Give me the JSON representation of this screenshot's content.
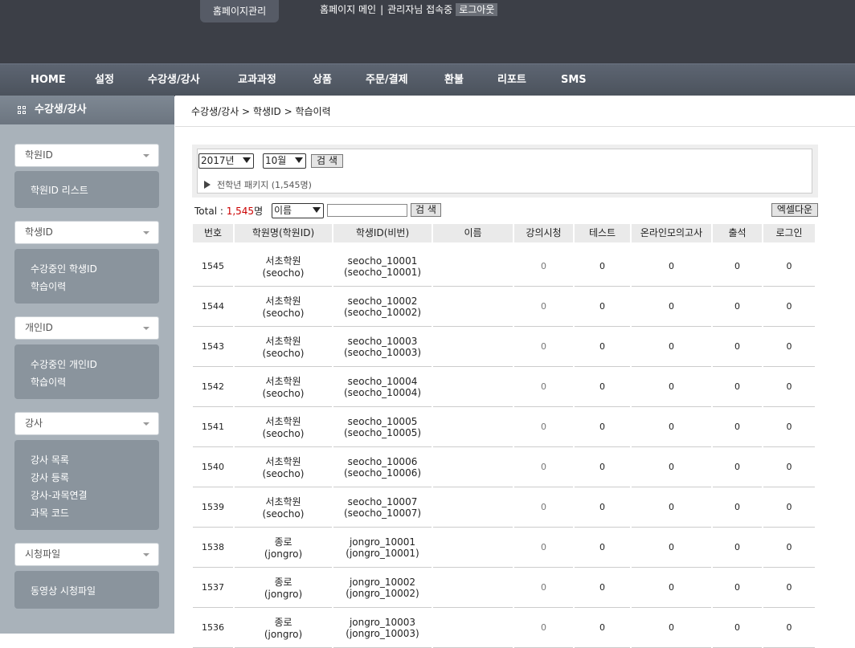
{
  "top": {
    "tab": "홈페이지관리",
    "home_link": "홈페이지 메인",
    "separator": "|",
    "admin_status": "관리자님 접속중",
    "logout": "로그아웃"
  },
  "nav": [
    "HOME",
    "설정",
    "수강생/강사",
    "교과과정",
    "상품",
    "주문/결제",
    "환불",
    "리포트",
    "SMS"
  ],
  "sidebar": {
    "title": "수강생/강사",
    "groups": [
      {
        "select": "학원ID",
        "links": [
          "학원ID 리스트"
        ]
      },
      {
        "select": "학생ID",
        "links": [
          "수강중인 학생ID",
          "학습이력"
        ]
      },
      {
        "select": "개인ID",
        "links": [
          "수강중인 개인ID",
          "학습이력"
        ]
      },
      {
        "select": "강사",
        "links": [
          "강사 목록",
          "강사 등록",
          "강사-과목연결",
          "과목 코드"
        ]
      },
      {
        "select": "시청파일",
        "links": [
          "동영상 시청파일"
        ]
      }
    ]
  },
  "breadcrumb": "수강생/강사 > 학생ID > 학습이력",
  "search": {
    "year": "2017년",
    "month": "10월",
    "search_btn": "검 색",
    "package": "전학년 패키지 (1,545명)"
  },
  "list_bar": {
    "total_label": "Total : ",
    "total_value": "1,545",
    "total_unit": "명",
    "filter": "이름",
    "search_btn": "검 색",
    "excel_btn": "엑셀다운"
  },
  "table": {
    "headers": [
      "번호",
      "학원명(학원ID)",
      "학생ID(비번)",
      "이름",
      "강의시청",
      "테스트",
      "온라인모의고사",
      "출석",
      "로그인"
    ],
    "rows": [
      {
        "no": "1545",
        "academy": "서초학원",
        "academy_id": "(seocho)",
        "student": "seocho_10001",
        "pw": "(seocho_10001)",
        "name": "",
        "lecture": "0",
        "test": "0",
        "mock": "0",
        "attend": "0",
        "login": "0"
      },
      {
        "no": "1544",
        "academy": "서초학원",
        "academy_id": "(seocho)",
        "student": "seocho_10002",
        "pw": "(seocho_10002)",
        "name": "",
        "lecture": "0",
        "test": "0",
        "mock": "0",
        "attend": "0",
        "login": "0"
      },
      {
        "no": "1543",
        "academy": "서초학원",
        "academy_id": "(seocho)",
        "student": "seocho_10003",
        "pw": "(seocho_10003)",
        "name": "",
        "lecture": "0",
        "test": "0",
        "mock": "0",
        "attend": "0",
        "login": "0"
      },
      {
        "no": "1542",
        "academy": "서초학원",
        "academy_id": "(seocho)",
        "student": "seocho_10004",
        "pw": "(seocho_10004)",
        "name": "",
        "lecture": "0",
        "test": "0",
        "mock": "0",
        "attend": "0",
        "login": "0"
      },
      {
        "no": "1541",
        "academy": "서초학원",
        "academy_id": "(seocho)",
        "student": "seocho_10005",
        "pw": "(seocho_10005)",
        "name": "",
        "lecture": "0",
        "test": "0",
        "mock": "0",
        "attend": "0",
        "login": "0"
      },
      {
        "no": "1540",
        "academy": "서초학원",
        "academy_id": "(seocho)",
        "student": "seocho_10006",
        "pw": "(seocho_10006)",
        "name": "",
        "lecture": "0",
        "test": "0",
        "mock": "0",
        "attend": "0",
        "login": "0"
      },
      {
        "no": "1539",
        "academy": "서초학원",
        "academy_id": "(seocho)",
        "student": "seocho_10007",
        "pw": "(seocho_10007)",
        "name": "",
        "lecture": "0",
        "test": "0",
        "mock": "0",
        "attend": "0",
        "login": "0"
      },
      {
        "no": "1538",
        "academy": "종로",
        "academy_id": "(jongro)",
        "student": "jongro_10001",
        "pw": "(jongro_10001)",
        "name": "",
        "lecture": "0",
        "test": "0",
        "mock": "0",
        "attend": "0",
        "login": "0"
      },
      {
        "no": "1537",
        "academy": "종로",
        "academy_id": "(jongro)",
        "student": "jongro_10002",
        "pw": "(jongro_10002)",
        "name": "",
        "lecture": "0",
        "test": "0",
        "mock": "0",
        "attend": "0",
        "login": "0"
      },
      {
        "no": "1536",
        "academy": "종로",
        "academy_id": "(jongro)",
        "student": "jongro_10003",
        "pw": "(jongro_10003)",
        "name": "",
        "lecture": "0",
        "test": "0",
        "mock": "0",
        "attend": "0",
        "login": "0"
      }
    ]
  }
}
